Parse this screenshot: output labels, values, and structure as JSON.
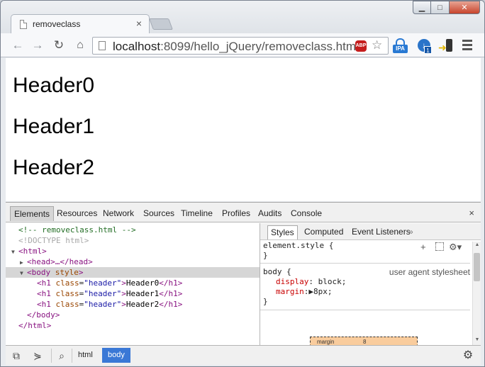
{
  "tab": {
    "title": "removeclass",
    "close": "×"
  },
  "window_controls": {
    "minimize": "▁",
    "maximize": "□",
    "close": "✕"
  },
  "toolbar": {
    "back": "←",
    "forward": "→",
    "reload": "↻",
    "home": "⌂",
    "url_host": "localhost",
    "url_rest": ":8099/hello_jQuery/removeclass.html",
    "abp_label": "ABP",
    "star": "☆",
    "ipa_label": "IPA",
    "download_glyph": "↓",
    "download_badge": "1"
  },
  "page": {
    "headers": [
      "Header0",
      "Header1",
      "Header2"
    ]
  },
  "devtools": {
    "tabs": [
      "Elements",
      "Resources",
      "Network",
      "Sources",
      "Timeline",
      "Profiles",
      "Audits",
      "Console"
    ],
    "active_tab": "Elements",
    "close": "×",
    "dom": {
      "comment": "<!-- removeclass.html -->",
      "doctype": "<!DOCTYPE html>",
      "html_open": "<html>",
      "head": "<head>…</head>",
      "body_open_tag": "<body",
      "body_attr": "style",
      "body_close_bracket": ">",
      "h1_rows": [
        {
          "attr": "class",
          "val": "\"header\"",
          "text": "Header0"
        },
        {
          "attr": "class",
          "val": "\"header\"",
          "text": "Header1"
        },
        {
          "attr": "class",
          "val": "\"header\"",
          "text": "Header2"
        }
      ],
      "h1_open": "<h1",
      "h1_close": "</h1>",
      "body_close": "</body>",
      "html_close": "</html>"
    },
    "styles": {
      "tabs": [
        "Styles",
        "Computed",
        "Event Listeners"
      ],
      "more": "»",
      "element_style_selector": "element.style {",
      "close_brace": "}",
      "body_selector": "body {",
      "body_source": "user agent stylesheet",
      "props": [
        {
          "name": "display",
          "value": " block;"
        },
        {
          "name": "margin",
          "value": "▶8px;"
        }
      ],
      "add_icon": "+",
      "gear_icon": "⚙▾",
      "boxmodel_label": "margin",
      "boxmodel_value": "8"
    },
    "breadcrumbs": [
      "html",
      "body"
    ],
    "active_crumb": "body"
  }
}
